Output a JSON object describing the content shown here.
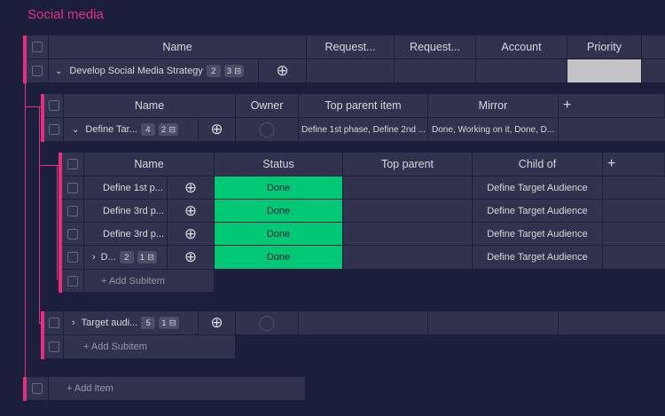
{
  "page": {
    "title": "Social media"
  },
  "board": {
    "columns": [
      "Name",
      "Request...",
      "Request...",
      "Account",
      "Priority"
    ],
    "item": {
      "name": "Develop Social Media Strategy",
      "updates_count": "2",
      "subitems_count": "3",
      "priority_color": "#c4c4c4"
    },
    "add_item": "+ Add Item"
  },
  "subitems": {
    "columns": [
      "Name",
      "Owner",
      "Top parent item",
      "Mirror",
      "+"
    ],
    "rows": [
      {
        "name": "Define Tar...",
        "updates_count": "4",
        "subitems_count": "2",
        "top_parent": "Define 1st phase, Define 2nd ...",
        "mirror": "Done, Working on it, Done, D..."
      },
      {
        "name": "Target audi...",
        "updates_count": "5",
        "subitems_count": "1",
        "top_parent": "",
        "mirror": ""
      }
    ],
    "add_subitem": "+ Add Subitem"
  },
  "nested": {
    "columns": [
      "Name",
      "Status",
      "Top parent",
      "Child of",
      "+"
    ],
    "rows": [
      {
        "name": "Define 1st p...",
        "status": "Done",
        "child_of": "Define Target Audience"
      },
      {
        "name": "Define 3rd p...",
        "status": "Done",
        "child_of": "Define Target Audience"
      },
      {
        "name": "Define 3rd p...",
        "status": "Done",
        "child_of": "Define Target Audience"
      },
      {
        "name": "D...",
        "updates_count": "2",
        "subitems_count": "1",
        "status": "Done",
        "child_of": "Define Target Audience"
      }
    ],
    "add_subitem": "+ Add Subitem",
    "status_color": "#00c875"
  },
  "colors": {
    "accent": "#e2307f",
    "background": "#1c1f3b",
    "cell": "#30324e"
  }
}
